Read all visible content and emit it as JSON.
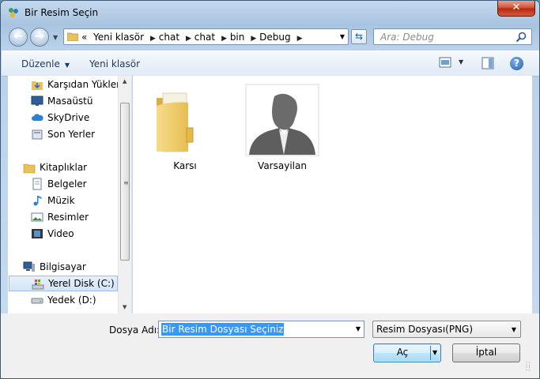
{
  "window": {
    "title": "Bir Resim Seçin",
    "close_label": "✕"
  },
  "navbar": {
    "back_icon": "back-arrow-icon",
    "forward_icon": "forward-arrow-icon",
    "address_prefix": "«",
    "breadcrumb": [
      "Yeni klasör",
      "chat",
      "chat",
      "bin",
      "Debug"
    ],
    "search_placeholder": "Ara: Debug"
  },
  "toolbar": {
    "organize_label": "Düzenle",
    "new_folder_label": "Yeni klasör"
  },
  "sidebar": {
    "items": [
      {
        "label": "Karşıdan Yüklem",
        "icon": "download-folder-icon",
        "kind": "child"
      },
      {
        "label": "Masaüstü",
        "icon": "desktop-icon",
        "kind": "child"
      },
      {
        "label": "SkyDrive",
        "icon": "cloud-icon",
        "kind": "child"
      },
      {
        "label": "Son Yerler",
        "icon": "recent-places-icon",
        "kind": "child"
      },
      {
        "label": "Kitaplıklar",
        "icon": "libraries-icon",
        "kind": "group"
      },
      {
        "label": "Belgeler",
        "icon": "documents-icon",
        "kind": "child"
      },
      {
        "label": "Müzik",
        "icon": "music-icon",
        "kind": "child"
      },
      {
        "label": "Resimler",
        "icon": "pictures-icon",
        "kind": "child"
      },
      {
        "label": "Video",
        "icon": "video-icon",
        "kind": "child"
      },
      {
        "label": "Bilgisayar",
        "icon": "computer-icon",
        "kind": "group"
      },
      {
        "label": "Yerel Disk (C:)",
        "icon": "windows-drive-icon",
        "kind": "child",
        "selected": true
      },
      {
        "label": "Yedek (D:)",
        "icon": "drive-icon",
        "kind": "child"
      }
    ]
  },
  "files": [
    {
      "label": "Karsı",
      "icon": "folder-icon"
    },
    {
      "label": "Varsayilan",
      "icon": "default-avatar-icon"
    }
  ],
  "bottom": {
    "filename_label": "Dosya Adı:",
    "filename_value": "Bir Resim Dosyası Seçiniz",
    "filetype_value": "Resim Dosyası(PNG)",
    "open_label": "Aç",
    "cancel_label": "İptal"
  },
  "colors": {
    "selection": "#3399ff",
    "accent": "#1d5fb0",
    "toolbar_text": "#1e395b"
  }
}
